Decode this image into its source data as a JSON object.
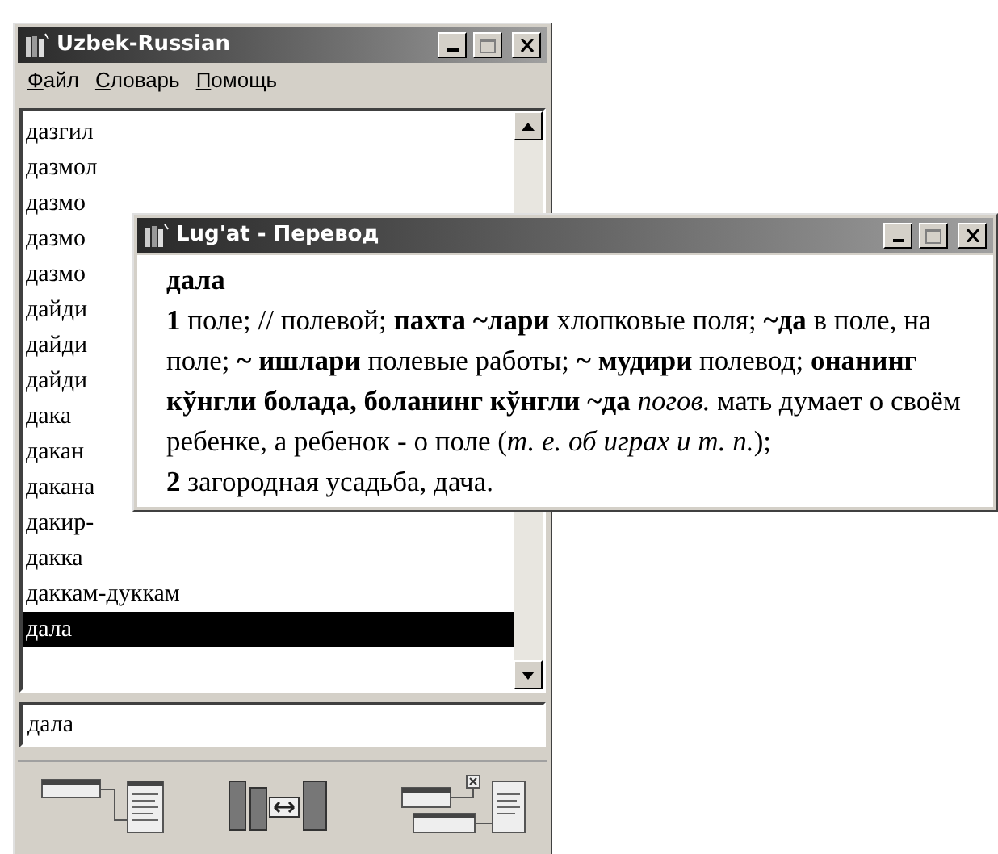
{
  "main_window": {
    "title": "Uzbek-Russian",
    "menu": [
      {
        "label": "Файл"
      },
      {
        "label": "Словарь"
      },
      {
        "label": "Помощь"
      }
    ],
    "word_list": [
      {
        "text": "дазгил",
        "selected": false
      },
      {
        "text": "дазмол",
        "selected": false
      },
      {
        "text": "дазмо",
        "selected": false
      },
      {
        "text": "дазмо",
        "selected": false
      },
      {
        "text": "дазмо",
        "selected": false
      },
      {
        "text": "дайди",
        "selected": false
      },
      {
        "text": "дайди",
        "selected": false
      },
      {
        "text": "дайди",
        "selected": false
      },
      {
        "text": "дака",
        "selected": false
      },
      {
        "text": "дакан",
        "selected": false
      },
      {
        "text": "дакана",
        "selected": false
      },
      {
        "text": "дакир-",
        "selected": false
      },
      {
        "text": "дакка",
        "selected": false
      },
      {
        "text": "даккам-дуккам",
        "selected": false
      },
      {
        "text": "дала",
        "selected": true
      }
    ],
    "search": {
      "value": "дала"
    }
  },
  "translation_window": {
    "title": "Lug'at - Перевод",
    "headword": "дала",
    "senses": [
      "**1** поле; // полевой; **пахта ~лари** хлопковые поля; **~да** в поле, на поле; **~ ишлари** полевые работы; **~ мудири** полевод; **онанинг кўнгли болада, боланинг кўнгли ~да** *погов.* мать думает о своём ребенке, а ребенок - о поле (*т. е. об играх и т. п.*);",
      "**2** загородная усадьба, дача."
    ]
  }
}
